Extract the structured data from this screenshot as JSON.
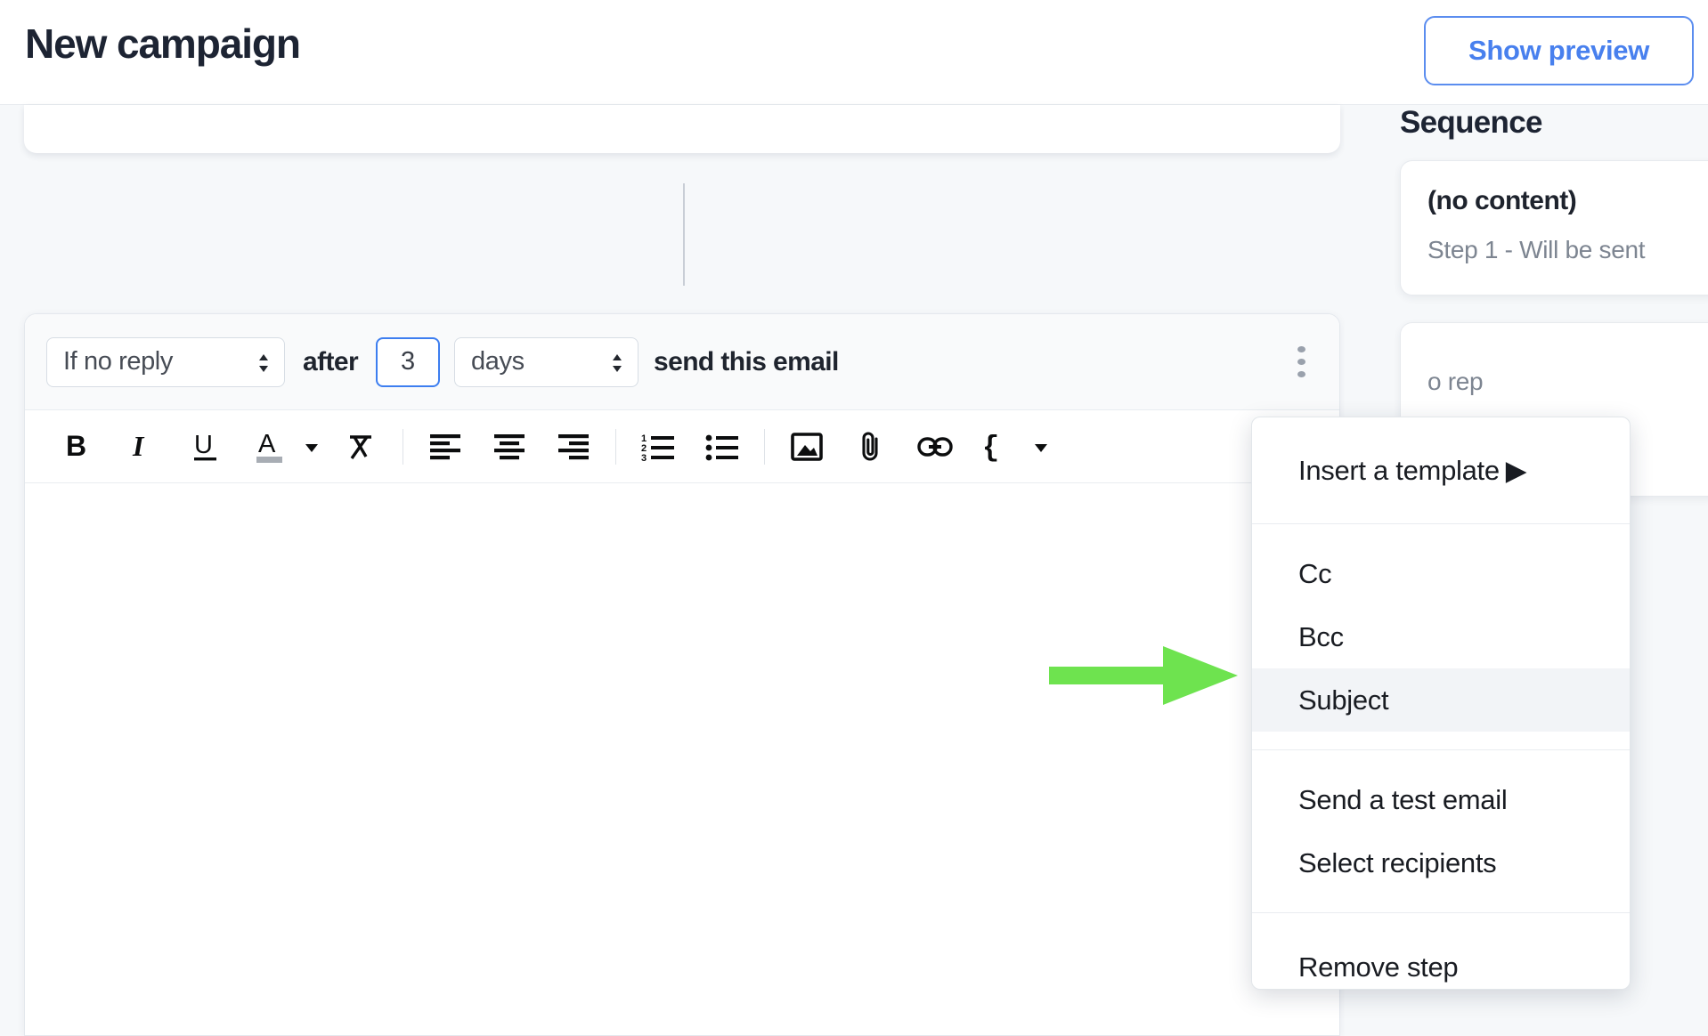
{
  "header": {
    "title": "New campaign",
    "preview_button": "Show preview"
  },
  "step": {
    "condition_select": {
      "value": "If no reply",
      "icon": "updown-chevrons-icon"
    },
    "after_label": "after",
    "delay_value": "3",
    "unit_select": {
      "value": "days",
      "icon": "updown-chevrons-icon"
    },
    "action_label": "send this email",
    "more_icon": "kebab-menu-icon"
  },
  "toolbar": {
    "items": [
      {
        "name": "bold-icon",
        "label": "B"
      },
      {
        "name": "italic-icon",
        "label": "I"
      },
      {
        "name": "underline-icon",
        "label": "U"
      },
      {
        "name": "text-color-icon",
        "label": "A"
      },
      {
        "name": "chevron-down-icon",
        "label": ""
      },
      {
        "name": "clear-formatting-icon",
        "label": ""
      },
      {
        "name": "align-left-icon",
        "label": ""
      },
      {
        "name": "align-center-icon",
        "label": ""
      },
      {
        "name": "align-right-icon",
        "label": ""
      },
      {
        "name": "ordered-list-icon",
        "label": ""
      },
      {
        "name": "bullet-list-icon",
        "label": ""
      },
      {
        "name": "insert-image-icon",
        "label": ""
      },
      {
        "name": "attachment-icon",
        "label": ""
      },
      {
        "name": "insert-link-icon",
        "label": ""
      },
      {
        "name": "variables-icon",
        "label": "{ }"
      },
      {
        "name": "chevron-down-icon",
        "label": ""
      }
    ]
  },
  "editor": {
    "body_text": ""
  },
  "sidebar": {
    "title": "Sequence",
    "cards": [
      {
        "title": "(no content)",
        "subtitle": "Step 1 - Will be sent"
      },
      {
        "title": "",
        "subtitle": "o rep"
      }
    ]
  },
  "menu": {
    "items": [
      {
        "label": "Insert a template",
        "has_submenu": true,
        "submenu_arrow": "▶",
        "active": false
      },
      {
        "label": "Cc",
        "has_submenu": false,
        "submenu_arrow": "",
        "active": false
      },
      {
        "label": "Bcc",
        "has_submenu": false,
        "submenu_arrow": "",
        "active": false
      },
      {
        "label": "Subject",
        "has_submenu": false,
        "submenu_arrow": "",
        "active": true
      },
      {
        "label": "Send a test email",
        "has_submenu": false,
        "submenu_arrow": "",
        "active": false
      },
      {
        "label": "Select recipients",
        "has_submenu": false,
        "submenu_arrow": "",
        "active": false
      },
      {
        "label": "Remove step",
        "has_submenu": false,
        "submenu_arrow": "",
        "active": false
      }
    ]
  },
  "annotation": {
    "arrow_color": "#6ee34f",
    "points_to": "Subject"
  },
  "colors": {
    "accent_blue": "#4880ee",
    "title_navy": "#1d2433",
    "canvas_bg": "#f6f8fa",
    "highlight_row": "#f2f4f7"
  }
}
